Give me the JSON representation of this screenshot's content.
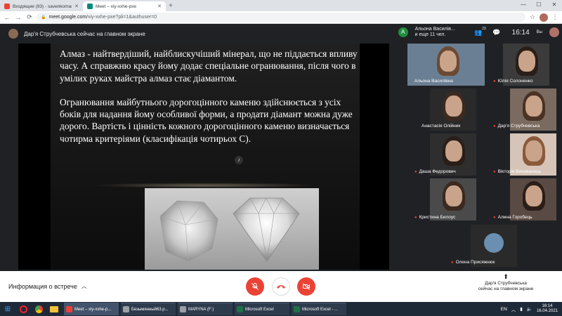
{
  "colors": {
    "meet_dark": "#202124",
    "tile_bg": "#3c4043",
    "hangup_red": "#ea4335",
    "chrome_tabstrip": "#dee1e6"
  },
  "browser": {
    "tabs": [
      {
        "title": "Входящие (93) - savenkomarina@",
        "favicon_color": "#ea4335",
        "active": false
      },
      {
        "title": "Meet – xiy-xxhe-pxe",
        "favicon_color": "#00897b",
        "active": true
      }
    ],
    "url_domain": "meet.google.com",
    "url_path": "/xiy-xxhe-pxe?pli=1&authuser=0"
  },
  "meet": {
    "presenting_banner": "Дар'я Струбчевська сейчас на главном экране",
    "header": {
      "first_participant_initial": "А",
      "participants_line1": "Альона Василів...",
      "participants_line2": "и еще 11 чел.",
      "people_count": "23",
      "time": "16:14",
      "you_label": "Вы"
    },
    "slide": {
      "paragraph1": "Алмаз - найтвердіший, найблискучіший мінерал, що не піддається впливу часу. А справжню красу йому додає спеціальне огранювання, після чого в умілих руках майстра алмаз стає діамантом.",
      "paragraph2": "Огранювання майбутнього дорогоцінного каменю здійснюється з усіх боків для надання йому особливої форми, а продати діамант можна дуже дорого. Вартість і цінність кожного дорогоцінного каменю визначається чотирма критеріями (класифікація чотирьох С)."
    },
    "participants": [
      {
        "name": "Альона Василівна",
        "muted": false,
        "bg": "#6a7f93",
        "hair": "#6b4a34"
      },
      {
        "name": "Юлія Солоненко",
        "muted": true,
        "bg": "#3b3b3b",
        "hair": "#2a1e18"
      },
      {
        "name": "Анастасія Олійник",
        "muted": false,
        "bg": "#2a2a2a",
        "hair": "#3a2a20"
      },
      {
        "name": "Дар'я Струбчевська",
        "muted": true,
        "bg": "#7a6a60",
        "hair": "#4a3224"
      },
      {
        "name": "Даша Федорович",
        "muted": true,
        "bg": "#2e2e2e",
        "hair": "#2a1e18"
      },
      {
        "name": "Вікторія Вихованець",
        "muted": true,
        "bg": "#d6c4b8",
        "hair": "#8a5a3a"
      },
      {
        "name": "Кристина Билоус",
        "muted": true,
        "bg": "#4a4a4a",
        "hair": "#3a2a20"
      },
      {
        "name": "Алина Горобець",
        "muted": true,
        "bg": "#5a4a44",
        "hair": "#2a1e18"
      },
      {
        "name": "Олена Присяжнюк",
        "muted": true,
        "bg": "#2a2a2a",
        "hair": "#6a8fb0"
      }
    ],
    "controls": {
      "meeting_info": "Информация о встрече",
      "present_now_line1": "Дар'я Струбчевська",
      "present_now_line2": "сейчас на главном экране"
    }
  },
  "taskbar": {
    "tasks": [
      {
        "label": "Meet – xiy-xxhe-p...",
        "color": "#ea4335"
      },
      {
        "label": "Безымянный63.p...",
        "color": "#9aa0a6"
      },
      {
        "label": "MARYNA (F:)",
        "color": "#9aa0a6"
      },
      {
        "label": "Microsoft Excel",
        "color": "#1e7145"
      },
      {
        "label": "Microsoft Excel - ...",
        "color": "#1e7145"
      }
    ],
    "lang": "EN",
    "time": "16:14",
    "date": "16.04.2021"
  }
}
